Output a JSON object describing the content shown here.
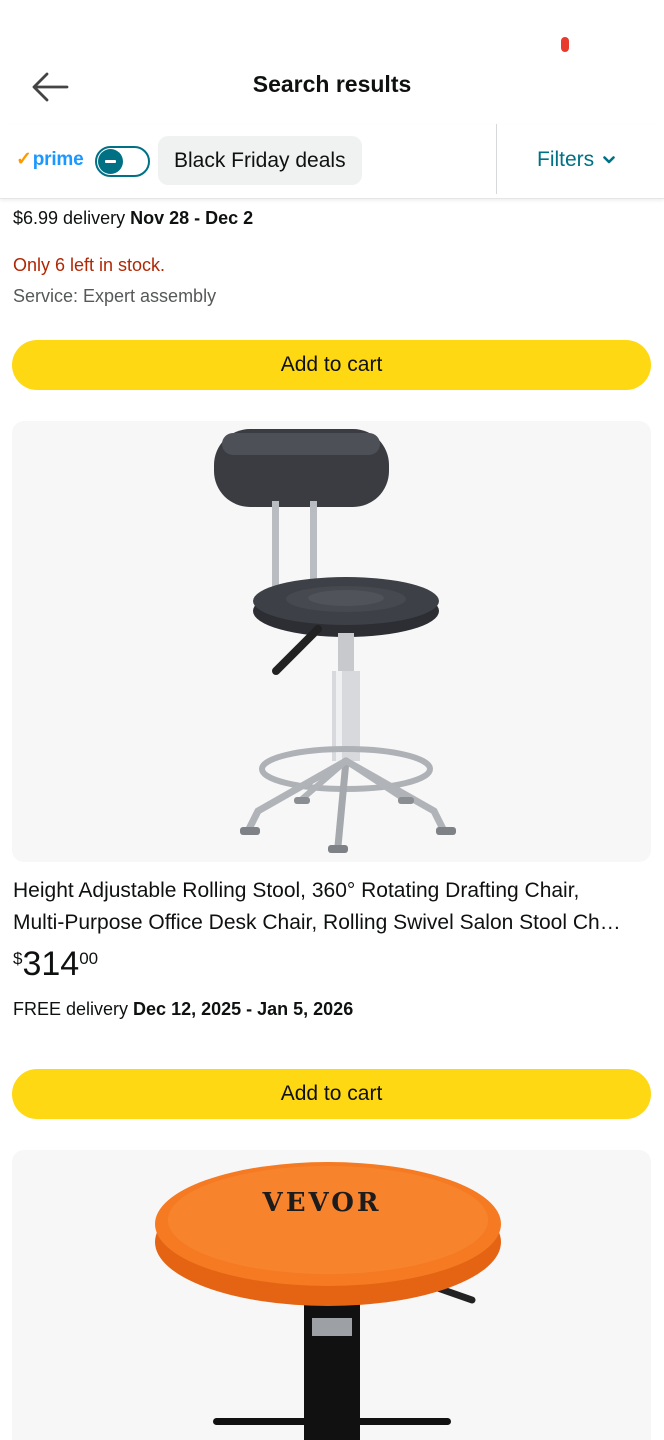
{
  "header": {
    "title": "Search results"
  },
  "filterbar": {
    "prime_check": "✓",
    "prime_label": "prime",
    "prime_toggle_on": false,
    "chip_label": "Black Friday deals",
    "filters_label": "Filters"
  },
  "item1": {
    "delivery_prefix": "$6.99 delivery ",
    "delivery_dates": "Nov 28 - Dec 2",
    "stock": "Only 6 left in stock.",
    "service": "Service: Expert assembly",
    "cart_label": "Add to cart"
  },
  "item2": {
    "title_line1": "Height Adjustable Rolling Stool, 360° Rotating Drafting Chair,",
    "title_line2": "Multi-Purpose Office Desk Chair, Rolling Swivel Salon Stool Ch…",
    "price_symbol": "$",
    "price_whole": "314",
    "price_fraction": "00",
    "delivery_prefix": "FREE delivery ",
    "delivery_dates": "Dec 12, 2025 - Jan 5, 2026",
    "cart_label": "Add to cart"
  },
  "item3": {
    "brand": "VEVOR"
  },
  "colors": {
    "accent": "#007185",
    "cart": "#ffd814",
    "alert": "#b12704",
    "prime": "#1a98ff"
  },
  "icons": {
    "back": "arrow-left-icon",
    "filters": "chevron-down-icon",
    "prime": "check-icon"
  }
}
